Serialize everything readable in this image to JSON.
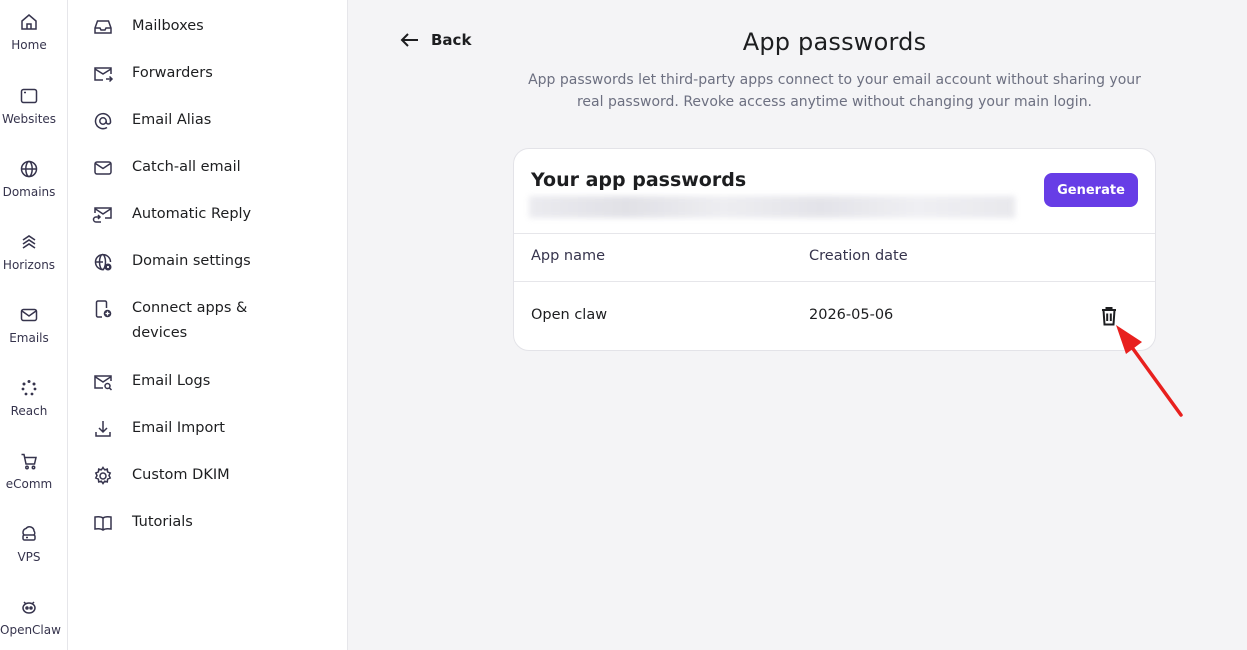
{
  "rail": {
    "items": [
      {
        "label": "Home",
        "icon": "home-icon"
      },
      {
        "label": "Websites",
        "icon": "browser-icon"
      },
      {
        "label": "Domains",
        "icon": "globe-icon"
      },
      {
        "label": "Horizons",
        "icon": "horizons-icon"
      },
      {
        "label": "Emails",
        "icon": "mail-icon"
      },
      {
        "label": "Reach",
        "icon": "reach-icon"
      },
      {
        "label": "eComm",
        "icon": "cart-icon"
      },
      {
        "label": "VPS",
        "icon": "cloud-server-icon"
      },
      {
        "label": "OpenClaw",
        "icon": "openclaw-icon"
      }
    ]
  },
  "menu": {
    "items": [
      {
        "label": "Mailboxes",
        "icon": "inbox-icon"
      },
      {
        "label": "Forwarders",
        "icon": "forward-mail-icon"
      },
      {
        "label": "Email Alias",
        "icon": "at-icon"
      },
      {
        "label": "Catch-all email",
        "icon": "mail-icon"
      },
      {
        "label": "Automatic Reply",
        "icon": "auto-reply-icon"
      },
      {
        "label": "Domain settings",
        "icon": "globe-settings-icon"
      },
      {
        "label": "Connect apps & devices",
        "icon": "device-add-icon"
      },
      {
        "label": "Email Logs",
        "icon": "mail-search-icon"
      },
      {
        "label": "Email Import",
        "icon": "download-icon"
      },
      {
        "label": "Custom DKIM",
        "icon": "gear-icon"
      },
      {
        "label": "Tutorials",
        "icon": "book-icon"
      }
    ]
  },
  "main": {
    "back_label": "Back",
    "title": "App passwords",
    "description": "App passwords let third-party apps connect to your email account without sharing your real password. Revoke access anytime without changing your main login.",
    "card": {
      "title": "Your app passwords",
      "generate_label": "Generate",
      "columns": [
        "App name",
        "Creation date"
      ],
      "rows": [
        {
          "app_name": "Open claw",
          "creation_date": "2026-05-06"
        }
      ]
    }
  },
  "colors": {
    "accent": "#673de6",
    "annotation_arrow": "#e8201e"
  }
}
